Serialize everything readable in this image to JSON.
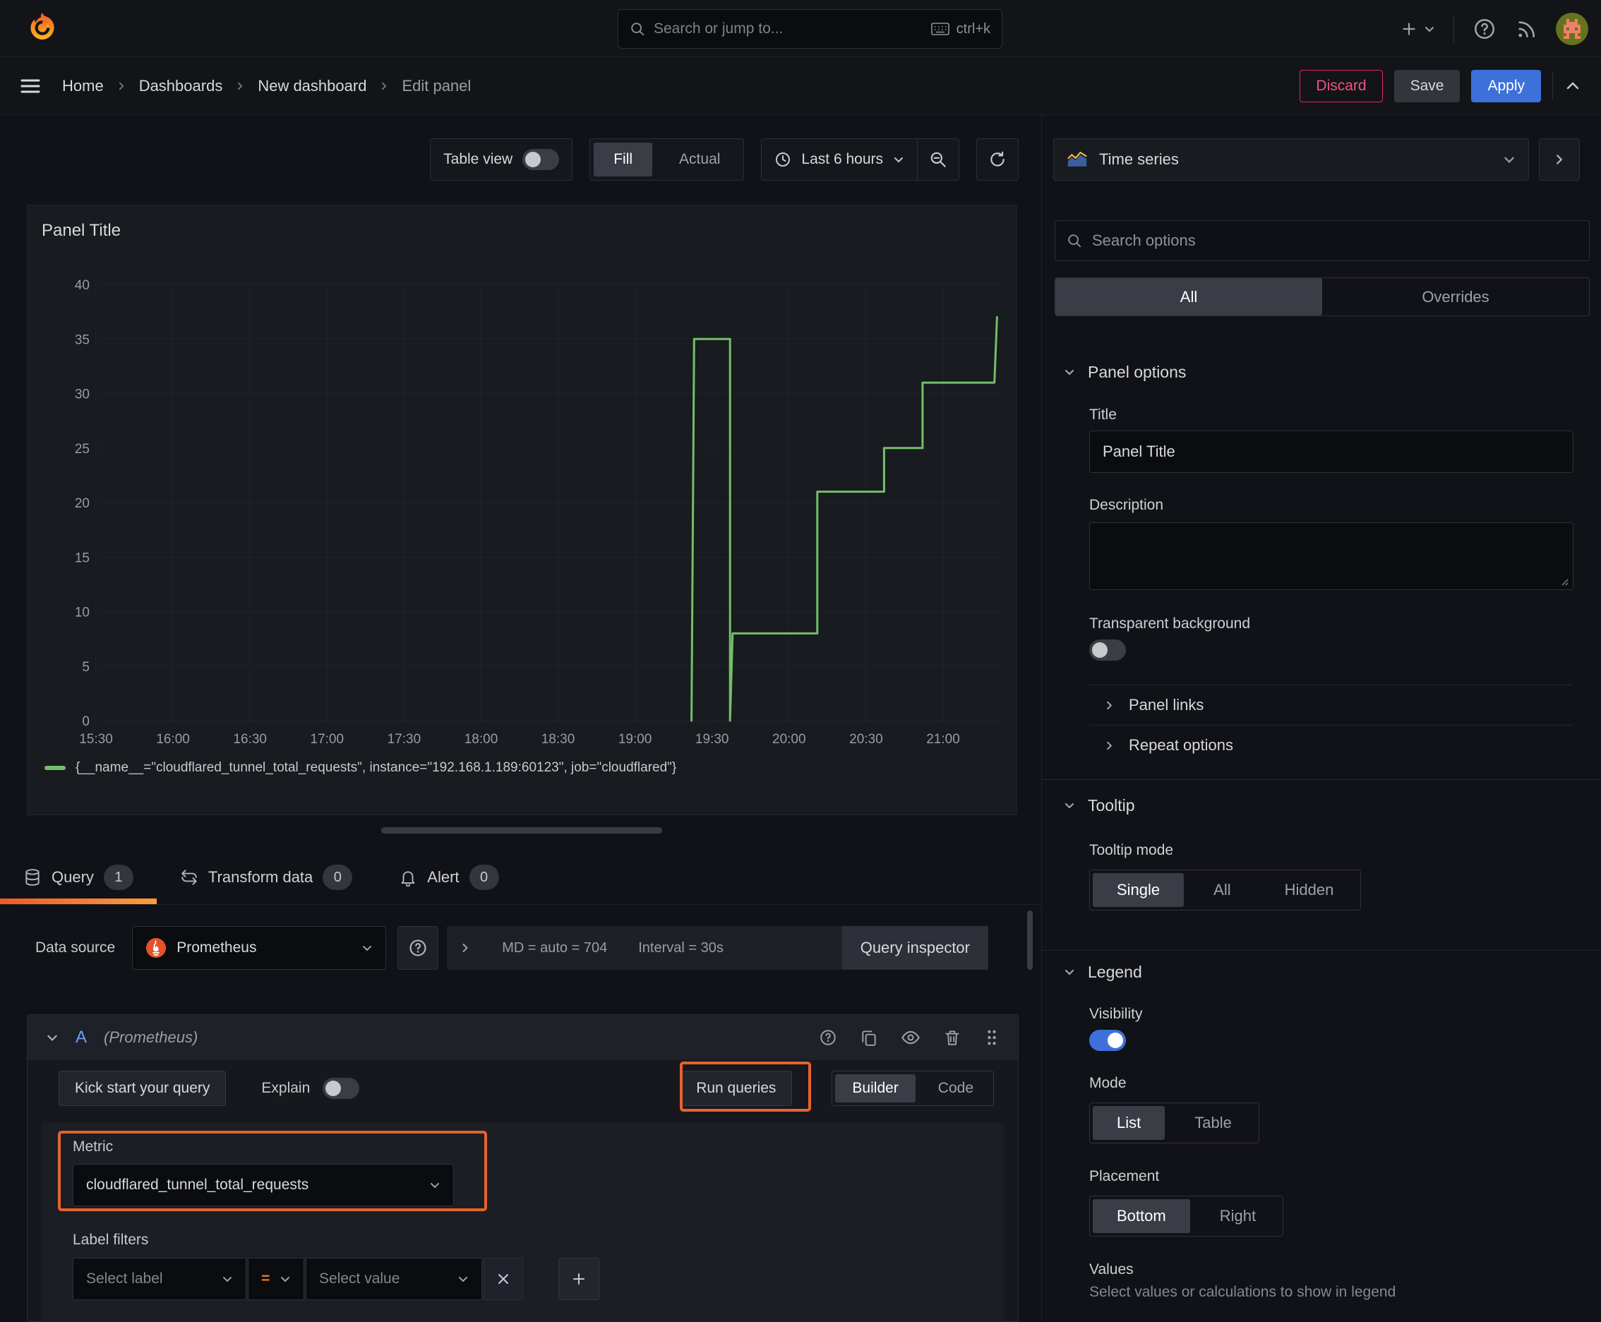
{
  "topbar": {
    "search_placeholder": "Search or jump to...",
    "shortcut": "ctrl+k"
  },
  "breadcrumb": {
    "items": [
      "Home",
      "Dashboards",
      "New dashboard",
      "Edit panel"
    ]
  },
  "actions": {
    "discard": "Discard",
    "save": "Save",
    "apply": "Apply"
  },
  "toolbar": {
    "table_view": "Table view",
    "fill": "Fill",
    "actual": "Actual",
    "time_range": "Last 6 hours"
  },
  "panel": {
    "title": "Panel Title"
  },
  "chart_data": {
    "type": "line",
    "title": "Panel Title",
    "x_ticks": [
      "15:30",
      "16:00",
      "16:30",
      "17:00",
      "17:30",
      "18:00",
      "18:30",
      "19:00",
      "19:30",
      "20:00",
      "20:30",
      "21:00"
    ],
    "y_ticks": [
      0,
      5,
      10,
      15,
      20,
      25,
      30,
      35,
      40
    ],
    "ylim": [
      0,
      40
    ],
    "grid": true,
    "legend_position": "bottom",
    "series": [
      {
        "name": "{__name__=\"cloudflared_tunnel_total_requests\", instance=\"192.168.1.189:60123\", job=\"cloudflared\"}",
        "color": "#73bf69",
        "points": [
          [
            "19:22",
            0
          ],
          [
            "19:23",
            35
          ],
          [
            "19:37",
            35
          ],
          [
            "19:37",
            0
          ],
          [
            "19:38",
            8
          ],
          [
            "20:11",
            8
          ],
          [
            "20:11",
            21
          ],
          [
            "20:37",
            21
          ],
          [
            "20:37",
            25
          ],
          [
            "20:52",
            25
          ],
          [
            "20:52",
            31
          ],
          [
            "21:20",
            31
          ],
          [
            "21:21",
            37
          ]
        ]
      }
    ]
  },
  "tabs": {
    "query": "Query",
    "query_badge": "1",
    "transform": "Transform data",
    "transform_badge": "0",
    "alert": "Alert",
    "alert_badge": "0"
  },
  "datasource": {
    "label": "Data source",
    "value": "Prometheus",
    "md": "MD = auto = 704",
    "interval": "Interval = 30s",
    "inspector": "Query inspector"
  },
  "query_row": {
    "ref": "A",
    "hint": "(Prometheus)",
    "kickstart": "Kick start your query",
    "explain": "Explain",
    "run": "Run queries",
    "builder": "Builder",
    "code": "Code",
    "metric_label": "Metric",
    "metric_value": "cloudflared_tunnel_total_requests",
    "filters_label": "Label filters",
    "select_label": "Select label",
    "operator": "=",
    "select_value": "Select value"
  },
  "sidebar": {
    "viz": "Time series",
    "search_placeholder": "Search options",
    "tab_all": "All",
    "tab_overrides": "Overrides",
    "panel_options": {
      "heading": "Panel options",
      "title_label": "Title",
      "title_value": "Panel Title",
      "description_label": "Description",
      "transparent": "Transparent background"
    },
    "links": "Panel links",
    "repeat": "Repeat options",
    "tooltip": {
      "heading": "Tooltip",
      "mode_label": "Tooltip mode",
      "single": "Single",
      "all": "All",
      "hidden": "Hidden",
      "active_mode": "Single"
    },
    "legend": {
      "heading": "Legend",
      "visibility": "Visibility",
      "mode_label": "Mode",
      "list": "List",
      "table": "Table",
      "active_mode": "List",
      "placement_label": "Placement",
      "bottom": "Bottom",
      "right": "Right",
      "active_placement": "Bottom",
      "values_label": "Values",
      "values_hint": "Select values or calculations to show in legend"
    }
  },
  "colors": {
    "accent_orange": "#e8622d",
    "series_green": "#73bf69",
    "primary_blue": "#3d71d9",
    "discard_pink": "#e0226e",
    "panel_bg": "#181b1f",
    "canvas_bg": "#111217"
  }
}
